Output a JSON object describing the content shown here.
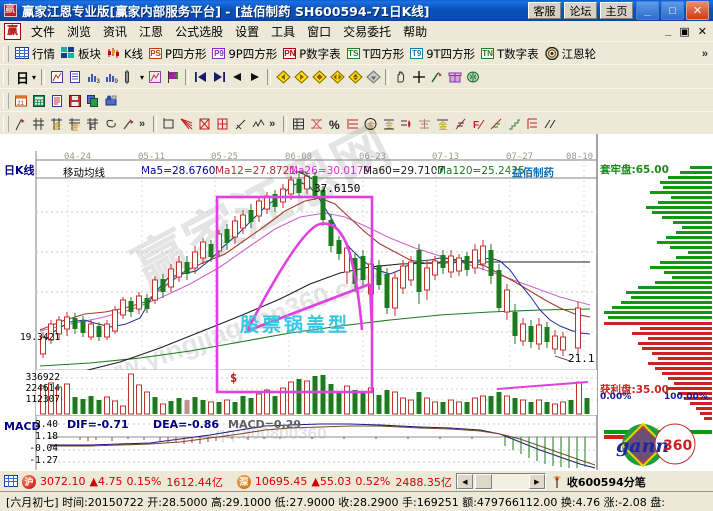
{
  "window": {
    "title": "赢家江恩专业版[赢家内部服务平台] - [益佰制药    SH600594-71日K线]",
    "buttons": [
      {
        "name": "customer-service",
        "label": "客服"
      },
      {
        "name": "forum",
        "label": "论坛"
      },
      {
        "name": "homepage",
        "label": "主页"
      }
    ],
    "controls": {
      "minimize": "_",
      "maximize": "□",
      "close": "✕"
    }
  },
  "menu": {
    "logo": "赢",
    "items": [
      "文件",
      "浏览",
      "资讯",
      "江恩",
      "公式选股",
      "设置",
      "工具",
      "窗口",
      "交易委托",
      "帮助"
    ],
    "mdi": {
      "minimize": "_",
      "restore": "▣",
      "close": "✕"
    }
  },
  "toolbar1": {
    "items": [
      {
        "name": "quotes",
        "label": "行情",
        "icon": "grid-icon",
        "badge": ""
      },
      {
        "name": "sector",
        "label": "板块",
        "icon": "blocks-icon",
        "badge": ""
      },
      {
        "name": "kline",
        "label": "K线",
        "icon": "candles-icon",
        "badge": ""
      },
      {
        "name": "p-square",
        "label": "P四方形",
        "icon": "label-icon",
        "badge": "PS"
      },
      {
        "name": "9p-square",
        "label": "9P四方形",
        "icon": "label-icon",
        "badge": "P9"
      },
      {
        "name": "p-number-table",
        "label": "P数字表",
        "icon": "label-icon",
        "badge": "PN"
      },
      {
        "name": "t-square",
        "label": "T四方形",
        "icon": "label-icon",
        "badge": "TS"
      },
      {
        "name": "9t-square",
        "label": "9T四方形",
        "icon": "label-icon",
        "badge": "T9"
      },
      {
        "name": "t-number-table",
        "label": "T数字表",
        "icon": "label-icon",
        "badge": "TN"
      },
      {
        "name": "gann-wheel",
        "label": "江恩轮",
        "icon": "target-icon",
        "badge": ""
      }
    ],
    "overflow": "»"
  },
  "toolbar2": {
    "period_label": "日",
    "period_caret": "▾",
    "icons": [
      "chart-pin-icon",
      "document-icon",
      "bars-3-icon",
      "bars-9-icon",
      "ruler-icon",
      "caret-icon",
      "target-crosshair-icon",
      "flag-icon",
      "first-page-icon",
      "last-page-icon",
      "prev-icon",
      "next-icon",
      "diamond-left-icon",
      "diamond-right-icon",
      "diamond-icon",
      "diamond-double-icon",
      "diamond-up-icon",
      "diamond-down-icon",
      "hand-icon",
      "crosshair-icon",
      "pen-icon",
      "gift-icon",
      "brain-icon"
    ]
  },
  "toolbar3": {
    "icons": [
      "calendar-icon",
      "calculator-icon",
      "report-icon",
      "save-icon",
      "copy-icon",
      "print-user-icon"
    ]
  },
  "toolbar4": {
    "group1": [
      "pen-red-icon",
      "hash-icon",
      "gann-gold-1-icon",
      "gann-gold-2-icon",
      "fib-f-icon",
      "spiral-icon",
      "brush-icon"
    ],
    "group1_overflow": "»",
    "group2": [
      "rect-icon",
      "fan-icon",
      "box-icon",
      "grid-box-icon",
      "angle-icon",
      "wave-icon"
    ],
    "group2_overflow": "»",
    "group3": [
      "table-icon",
      "percent-cross-icon",
      "percent-icon",
      "level-icon",
      "circle-gold-icon",
      "gold-bar-icon",
      "ink-icon",
      "balance-icon",
      "gold-icon",
      "rise-icon",
      "f-line-icon",
      "steps-icon",
      "stairs-icon",
      "bracket-icon",
      "zigzag-icon"
    ]
  },
  "chart": {
    "panel_label": "日K线",
    "ma_legend_title": "移动均线",
    "ma_values": [
      {
        "name": "ma5",
        "text": "Ma5=28.6760",
        "color": "#0000a0"
      },
      {
        "name": "ma12",
        "text": "Ma12=27.8721",
        "color": "#b03030"
      },
      {
        "name": "ma26",
        "text": "Ma26=30.0179",
        "color": "#cc33cc"
      },
      {
        "name": "ma60",
        "text": "Ma60=29.7107",
        "color": "#202020"
      },
      {
        "name": "ma120",
        "text": "Ma120=25.2425",
        "color": "#1e7a1e"
      }
    ],
    "stock_name": "益佰制药",
    "date_axis": [
      "04-24",
      "05-11",
      "05-25",
      "06-08",
      "06-23",
      "07-13",
      "07-27",
      "08-10"
    ],
    "high_label": "37.6150",
    "low_label": "21.1",
    "mid_price_label": "19.3421",
    "volume_labels": [
      "336922",
      "224614",
      "112307"
    ],
    "pattern_annotation": "股票锅盖型",
    "dollar_marker": "$"
  },
  "chip_panel": {
    "trapped_label": "套牢盘",
    "trapped_value": "65.00",
    "profit_label": "获利盘",
    "profit_value": "35.00",
    "scale_min": "0.00%",
    "scale_max": "100.00%"
  },
  "macd": {
    "panel_label": "MACD",
    "dif": "DIF=-0.71",
    "dea": "DEA=-0.86",
    "macd": "MACD=0.29",
    "y_labels": [
      "2.40",
      "1.18",
      "-0.04",
      "-1.27"
    ]
  },
  "ticker": {
    "index1": {
      "icon": "沪",
      "value": "3072.10",
      "arrow": "▲",
      "change": "4.75",
      "percent": "0.15%",
      "amount": "1612.44亿"
    },
    "index2": {
      "icon": "深",
      "value": "10695.45",
      "arrow": "▲",
      "change": "55.03",
      "percent": "0.52%",
      "amount": "2488.35亿"
    },
    "right_icon": "antenna-icon",
    "right_label": "收600594分笔"
  },
  "status": {
    "text": "[六月初七] 时间:20150722 开:28.5000 高:29.1000 低:27.9000 收:28.2900 手:169251 额:479766112.00 换:4.76 涨:-2.08 盘:"
  },
  "logo": {
    "text": "gann",
    "suffix": "360"
  },
  "watermark": {
    "line1": "赢家江恩网",
    "line2": "www.yingjiagann360.com",
    "line3": "qq:800800360"
  },
  "colors": {
    "up": "#d40000",
    "down": "#008000",
    "accent": "#e040e0",
    "title_bg": "#0a52b8",
    "chrome": "#ece9d8"
  }
}
